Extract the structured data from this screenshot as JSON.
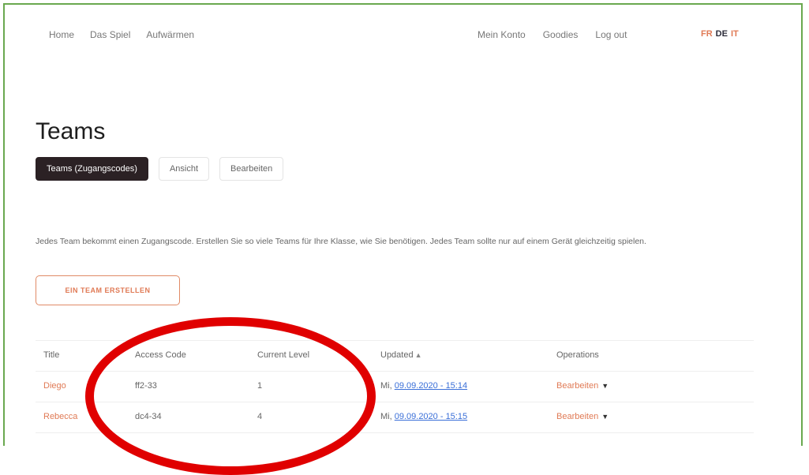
{
  "nav": {
    "left": [
      "Home",
      "Das Spiel",
      "Aufwärmen"
    ],
    "right": [
      "Mein Konto",
      "Goodies",
      "Log out"
    ],
    "languages": [
      "FR",
      "DE",
      "IT"
    ]
  },
  "page": {
    "title": "Teams",
    "tabs": [
      "Teams (Zugangscodes)",
      "Ansicht",
      "Bearbeiten"
    ],
    "intro": "Jedes Team bekommt einen Zugangscode. Erstellen Sie so viele Teams für Ihre Klasse, wie Sie benötigen. Jedes Team sollte nur auf einem Gerät gleichzeitig spielen.",
    "create_button": "EIN TEAM ERSTELLEN"
  },
  "table": {
    "headers": {
      "title": "Title",
      "access_code": "Access Code",
      "current_level": "Current Level",
      "updated": "Updated",
      "operations": "Operations"
    },
    "rows": [
      {
        "title": "Diego",
        "access_code": "ff2-33",
        "current_level": "1",
        "updated_prefix": "Mi,",
        "updated_date": "09.09.2020 - 15:14",
        "operations": "Bearbeiten"
      },
      {
        "title": "Rebecca",
        "access_code": "dc4-34",
        "current_level": "4",
        "updated_prefix": "Mi,",
        "updated_date": "09.09.2020 - 15:15",
        "operations": "Bearbeiten"
      }
    ]
  },
  "colors": {
    "accent": "#e07a55",
    "frame": "#6aa84f",
    "annotation": "#e00000",
    "link": "#3a6fd8",
    "active_tab": "#2b2124"
  }
}
